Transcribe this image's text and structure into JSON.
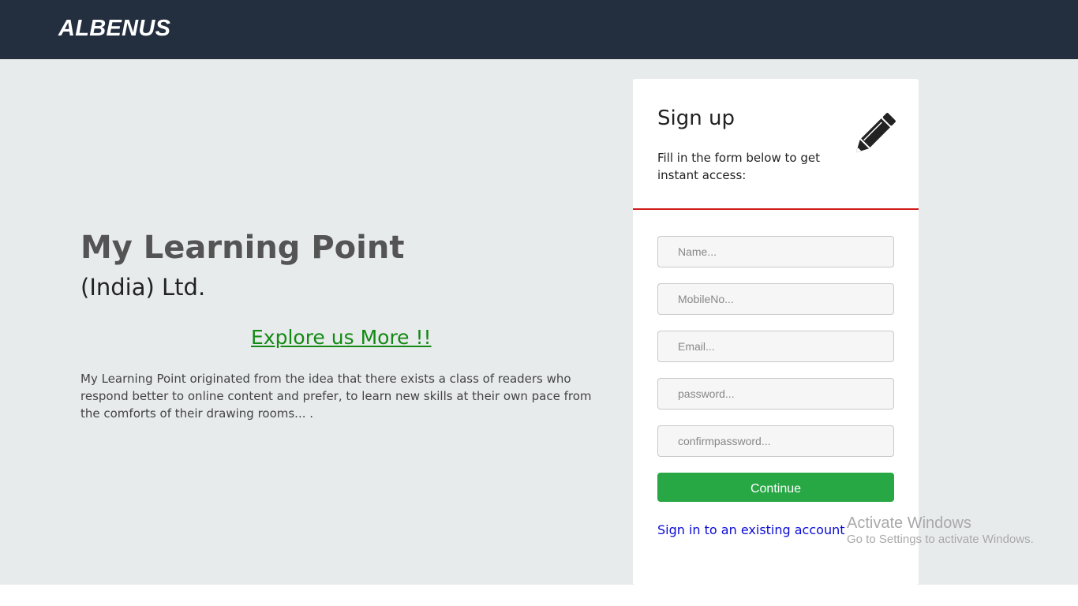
{
  "navbar": {
    "brand": "ALBENUS"
  },
  "hero": {
    "title": "My Learning Point",
    "subtitle": "(India) Ltd.",
    "explore_link": "Explore us More !!",
    "description": "My Learning Point originated from the idea that there exists a class of readers who respond better to online content and prefer, to learn new skills at their own pace from the comforts of their drawing rooms... ."
  },
  "signup": {
    "title": "Sign up",
    "subtitle": "Fill in the form below to get instant access:",
    "icon": "pencil-icon",
    "fields": {
      "name": {
        "placeholder": "Name...",
        "value": ""
      },
      "mobile": {
        "placeholder": "MobileNo...",
        "value": ""
      },
      "email": {
        "placeholder": "Email...",
        "value": ""
      },
      "password": {
        "placeholder": "password...",
        "value": ""
      },
      "confirm": {
        "placeholder": "confirmpassword...",
        "value": ""
      }
    },
    "continue_label": "Continue",
    "signin_link": "Sign in to an existing account"
  },
  "watermark": {
    "line1": "Activate Windows",
    "line2": "Go to Settings to activate Windows."
  },
  "colors": {
    "navbar": "#232e3f",
    "background": "#e8ebec",
    "accent_red": "#d11b1b",
    "button_green": "#28a745",
    "link_green": "#138a13",
    "link_blue": "#0a0ad6"
  }
}
